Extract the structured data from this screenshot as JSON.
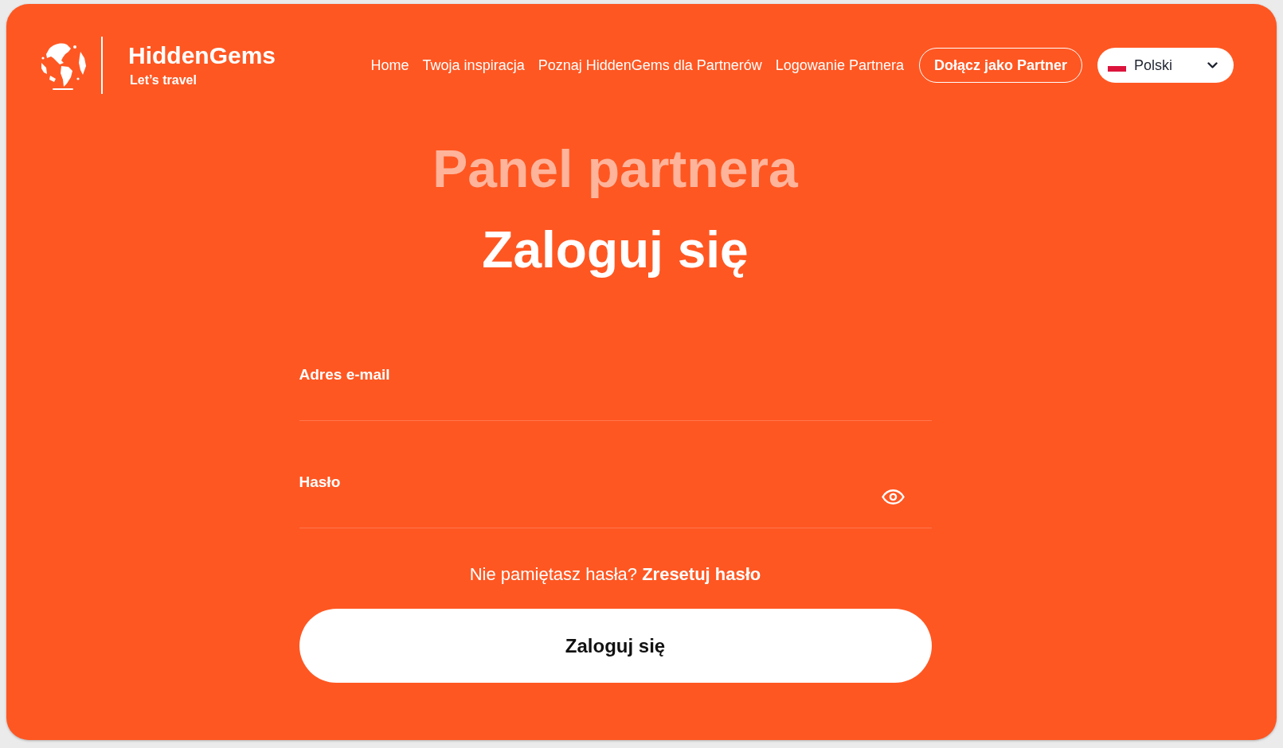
{
  "logo": {
    "name": "HiddenGems",
    "tagline": "Let’s travel"
  },
  "nav": {
    "links": [
      "Home",
      "Twoja inspiracja",
      "Poznaj HiddenGems dla Partnerów",
      "Logowanie Partnera"
    ],
    "cta": "Dołącz jako Partner",
    "language": {
      "value": "Polski"
    }
  },
  "hero": {
    "subtitle": "Panel partnera",
    "title": "Zaloguj się"
  },
  "form": {
    "fields": [
      {
        "label": "Adres e-mail",
        "kind": "email"
      },
      {
        "label": "Hasło",
        "kind": "password"
      }
    ],
    "forgot": {
      "text": "Nie pamiętasz hasła?",
      "link": "Zresetuj hasło"
    },
    "submit": "Zaloguj się"
  }
}
